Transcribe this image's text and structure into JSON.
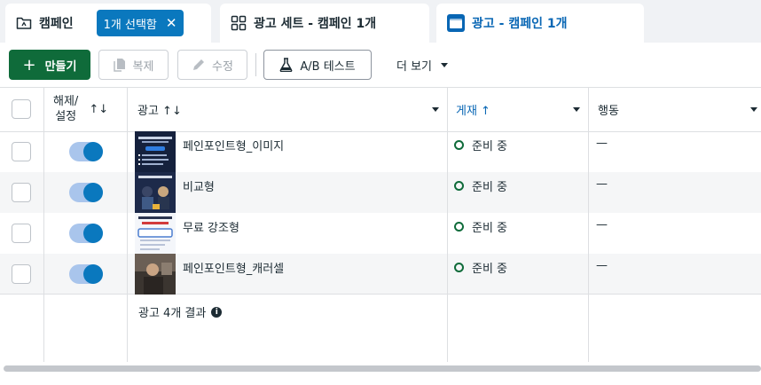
{
  "tabs": {
    "campaign": {
      "label": "캠페인",
      "selection": "1개 선택함",
      "clear": "✕"
    },
    "adset": {
      "label": "광고 세트 - 캠페인 1개"
    },
    "ad": {
      "label": "광고 - 캠페인 1개"
    }
  },
  "toolbar": {
    "create": "만들기",
    "create_plus": "+",
    "copy": "복제",
    "edit": "수정",
    "ab_test": "A/B 테스트",
    "more": "더 보기"
  },
  "table": {
    "headers": {
      "toggle_line1": "해제/",
      "toggle_line2": "설정",
      "toggle_sort": "↑↓",
      "ad": "광고 ↑↓",
      "delivery": "게재 ↑",
      "actions": "행동"
    },
    "rows": [
      {
        "name": "페인포인트형_이미지",
        "status": "준비 중",
        "action": "—",
        "enabled": true
      },
      {
        "name": "비교형",
        "status": "준비 중",
        "action": "—",
        "enabled": true
      },
      {
        "name": "무료 강조형",
        "status": "준비 중",
        "action": "—",
        "enabled": true
      },
      {
        "name": "페인포인트형_캐러셀",
        "status": "준비 중",
        "action": "—",
        "enabled": true
      }
    ],
    "result_text": "광고 4개 결과",
    "info_glyph": "i"
  },
  "colors": {
    "accent_blue": "#0a78be",
    "create_green": "#0f6b3a",
    "status_green": "#0f6b3a"
  }
}
